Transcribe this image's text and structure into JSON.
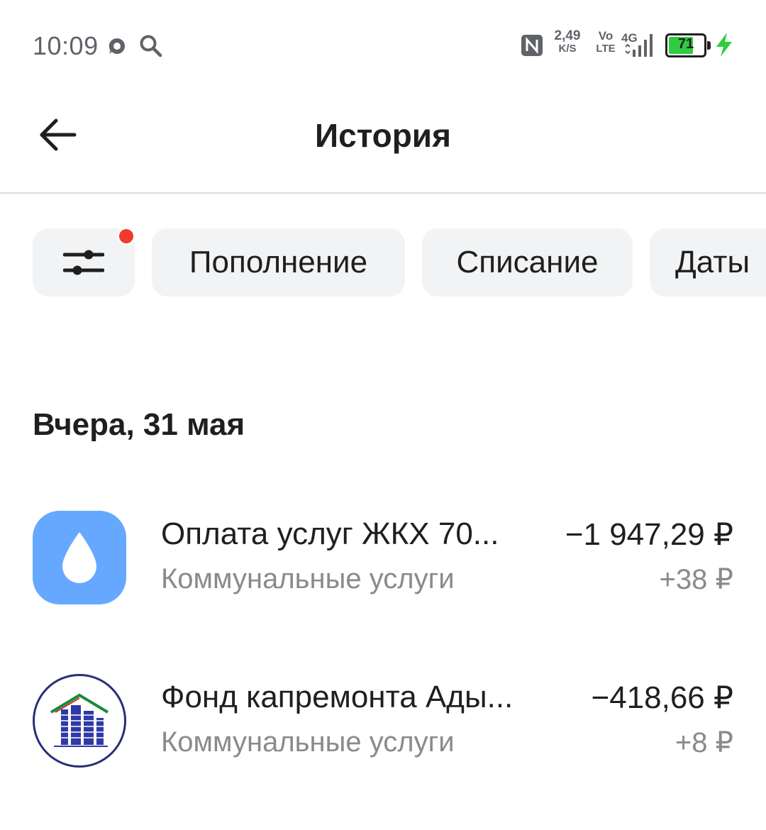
{
  "status_bar": {
    "time": "10:09",
    "icons": [
      "chat-bubble-icon",
      "search-icon",
      "nfc-icon",
      "signal-icon",
      "charging-icon"
    ],
    "net_speed_value": "2,49",
    "net_speed_unit": "K/S",
    "volte_top": "Vo",
    "volte_bottom": "LTE",
    "network_type": "4G",
    "battery_level": "71",
    "battery_fraction": 0.71,
    "battery_color": "#2ecc40"
  },
  "header": {
    "back_icon": "arrow-left-icon",
    "title": "История"
  },
  "filters": {
    "settings_icon": "sliders-icon",
    "has_active_filter": true,
    "chips": [
      {
        "label": "Пополнение"
      },
      {
        "label": "Списание"
      },
      {
        "label": "Даты"
      }
    ]
  },
  "history": {
    "section_date": "Вчера, 31 мая",
    "transactions": [
      {
        "icon": "water-drop-icon",
        "icon_color": "#66a8ff",
        "title": "Оплата услуг ЖКХ 70...",
        "category": "Коммунальные услуги",
        "amount": "−1 947,29 ₽",
        "cashback": "+38 ₽"
      },
      {
        "icon": "fund-logo-icon",
        "title": "Фонд капремонта Ады...",
        "category": "Коммунальные услуги",
        "amount": "−418,66 ₽",
        "cashback": "+8 ₽"
      }
    ]
  }
}
